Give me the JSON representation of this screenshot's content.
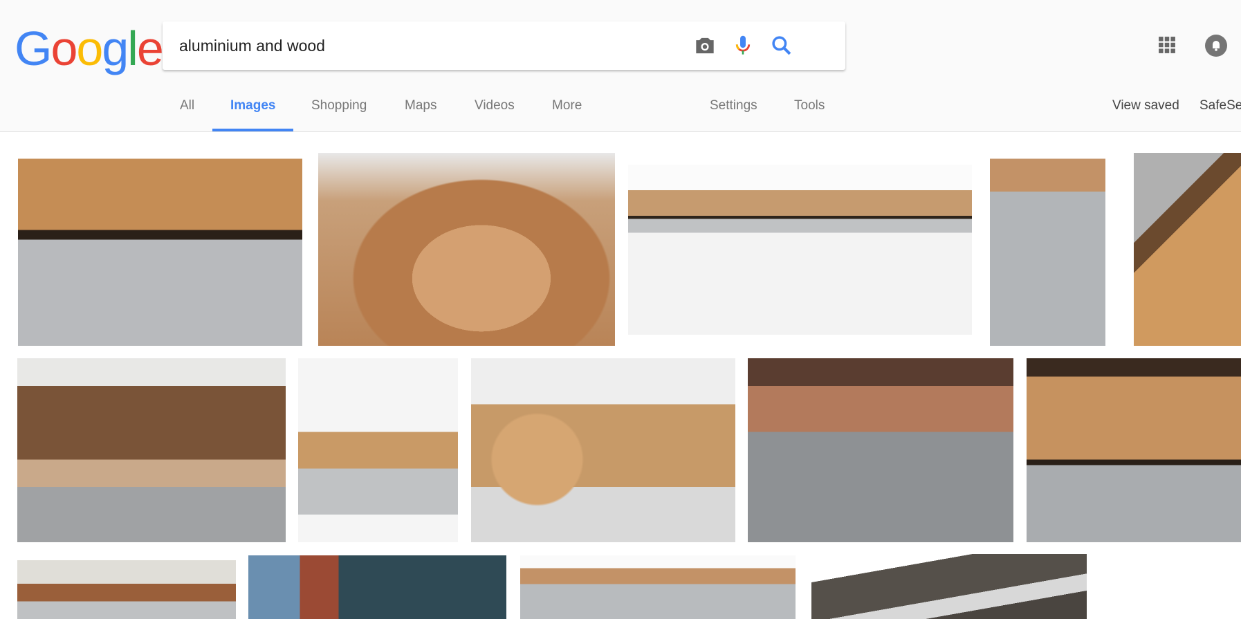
{
  "logo": {
    "letters": [
      "G",
      "o",
      "o",
      "g",
      "l",
      "e"
    ],
    "colors": [
      "#4285f4",
      "#ea4335",
      "#fbbc05",
      "#4285f4",
      "#34a853",
      "#ea4335"
    ]
  },
  "search": {
    "value": "aluminium and wood",
    "icons": [
      "camera-icon",
      "microphone-icon",
      "search-icon"
    ]
  },
  "tabs": [
    {
      "label": "All"
    },
    {
      "label": "Images",
      "active": true
    },
    {
      "label": "Shopping"
    },
    {
      "label": "Maps"
    },
    {
      "label": "Videos"
    },
    {
      "label": "More"
    },
    {
      "label": "Settings"
    },
    {
      "label": "Tools"
    }
  ],
  "right_links": {
    "view_saved": "View saved",
    "safesearch": "SafeSe"
  },
  "accent": "#4285f4",
  "image_palette": {
    "wood": "#c99a66",
    "dark_wood": "#6b4a2e",
    "aluminium": "#b9bcbf",
    "background": "#f2f2f2"
  }
}
